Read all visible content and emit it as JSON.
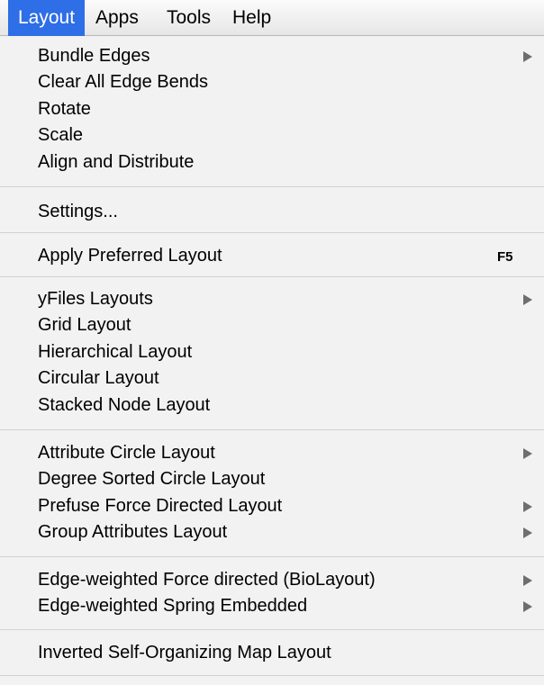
{
  "menubar": {
    "items": [
      "Layout",
      "Apps",
      "Tools",
      "Help"
    ],
    "active": "Layout"
  },
  "menu": {
    "items": {
      "bundle_edges": "Bundle Edges",
      "clear_all_edge_bends": "Clear All Edge Bends",
      "rotate": "Rotate",
      "scale": "Scale",
      "align_and_distribute": "Align and Distribute",
      "settings": "Settings...",
      "apply_preferred_layout": "Apply Preferred Layout",
      "apply_preferred_layout_shortcut": "F5",
      "yfiles_layouts": "yFiles Layouts",
      "grid_layout": "Grid Layout",
      "hierarchical_layout": "Hierarchical Layout",
      "circular_layout": "Circular Layout",
      "stacked_node_layout": "Stacked Node Layout",
      "attribute_circle_layout": "Attribute Circle Layout",
      "degree_sorted_circle_layout": "Degree Sorted Circle Layout",
      "prefuse_force_directed_layout": "Prefuse Force Directed Layout",
      "group_attributes_layout": "Group Attributes Layout",
      "edge_weighted_force_directed": "Edge-weighted Force directed (BioLayout)",
      "edge_weighted_spring_embedded": "Edge-weighted Spring Embedded",
      "inverted_self_organizing_map_layout": "Inverted Self-Organizing Map Layout"
    },
    "submenu_arrow_icon": "triangle-right-icon"
  }
}
